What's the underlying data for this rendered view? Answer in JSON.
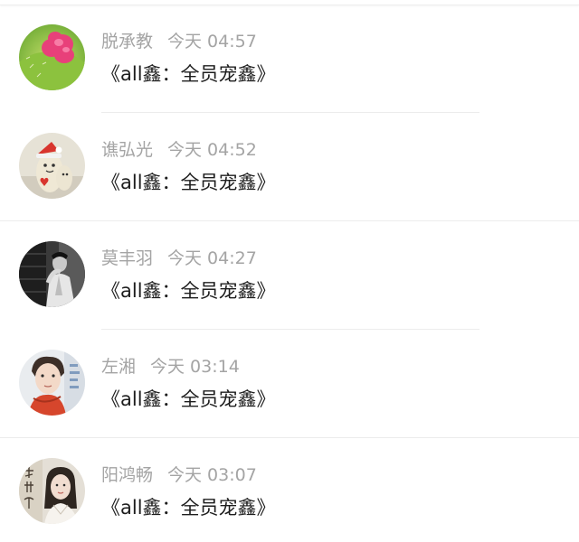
{
  "messages": [
    {
      "name": "脱承教",
      "time": "今天 04:57",
      "text": "《all鑫：全员宠鑫》",
      "avatar_icon": "cactus-flower-photo"
    },
    {
      "name": "谯弘光",
      "time": "今天 04:52",
      "text": "《all鑫：全员宠鑫》",
      "avatar_icon": "christmas-doll-photo"
    },
    {
      "name": "莫丰羽",
      "time": "今天 04:27",
      "text": "《all鑫：全员宠鑫》",
      "avatar_icon": "man-portrait-bw-photo"
    },
    {
      "name": "左湘",
      "time": "今天 03:14",
      "text": "《all鑫：全员宠鑫》",
      "avatar_icon": "young-man-red-scarf-photo"
    },
    {
      "name": "阳鸿畅",
      "time": "今天 03:07",
      "text": "《all鑫：全员宠鑫》",
      "avatar_icon": "woman-calligraphy-photo"
    }
  ]
}
